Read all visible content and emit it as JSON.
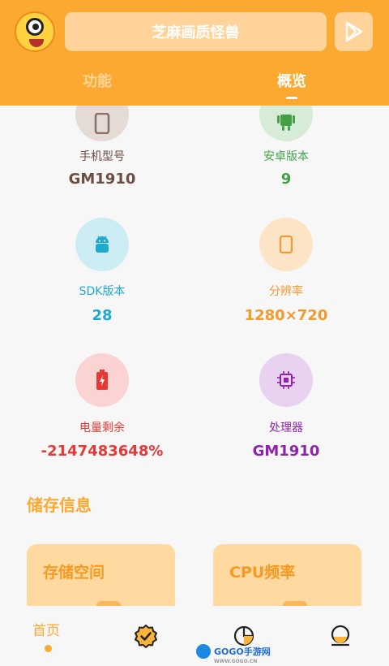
{
  "header": {
    "title": "芝麻画质怪兽",
    "avatar_icon": "cartoon-monster-avatar",
    "play_icon": "play-store-icon",
    "background": "#fba931"
  },
  "tabs": [
    {
      "label": "功能",
      "active": false
    },
    {
      "label": "概览",
      "active": true
    }
  ],
  "device_info": [
    {
      "label": "手机型号",
      "value": "GM1910",
      "icon": "phone-icon",
      "color": "#6d4c41",
      "bg": "#e4dad6"
    },
    {
      "label": "安卓版本",
      "value": "9",
      "icon": "android-icon",
      "color": "#43a047",
      "bg": "#d6ecd7"
    },
    {
      "label": "SDK版本",
      "value": "28",
      "icon": "android-head-icon",
      "color": "#1eaad0",
      "bg": "#ccedf3"
    },
    {
      "label": "分辨率",
      "value": "1280×720",
      "icon": "screen-icon",
      "color": "#f29a2e",
      "bg": "#fde4c6"
    },
    {
      "label": "电量剩余",
      "value": "-2147483648%",
      "icon": "battery-charging-icon",
      "color": "#e53935",
      "bg": "#fbd3d3"
    },
    {
      "label": "处理器",
      "value": "GM1910",
      "icon": "chip-icon",
      "color": "#8e24aa",
      "bg": "#e8d2ef"
    }
  ],
  "storage": {
    "section_title": "储存信息",
    "cards": [
      {
        "title": "存储空间"
      },
      {
        "title": "CPU频率"
      }
    ]
  },
  "bottom_nav": {
    "home_label": "首页",
    "items": [
      "home",
      "badge-check-icon",
      "chart-icon",
      "profile-icon"
    ]
  },
  "watermark": {
    "text": "GOGO手游网",
    "sub": "WWW.GOGO.CN"
  }
}
